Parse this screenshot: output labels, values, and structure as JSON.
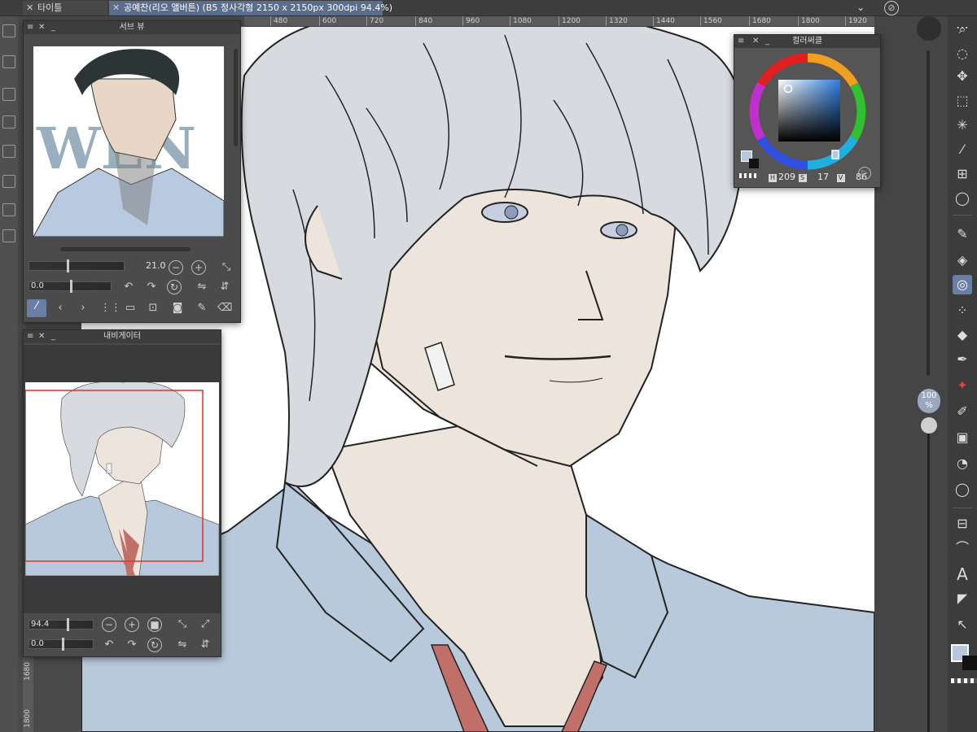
{
  "tabs": [
    {
      "label": "타이틀"
    },
    {
      "label": "공예찬(리오 앨버튼) (B5 정사각형 2150 x 2150px 300dpi 94.4%)"
    }
  ],
  "ruler": {
    "top_ticks": [
      "480",
      "600",
      "720",
      "840",
      "960",
      "1080",
      "1200",
      "1320",
      "1440",
      "1560",
      "1680",
      "1800",
      "1920"
    ],
    "left_ticks": [
      "1680",
      "1800"
    ]
  },
  "subview": {
    "title": "서브 뷰",
    "zoom_value": "21.0",
    "rotation_value": "0.0",
    "image_text": "WEN"
  },
  "navigator": {
    "title": "내비게이터",
    "zoom_value": "94.4",
    "rotation_value": "0.0"
  },
  "colorwheel": {
    "title": "컬러써클",
    "h_label": "H",
    "h_value": "209",
    "s_label": "S",
    "s_value": "17",
    "v_label": "V",
    "v_value": "86",
    "current_color": "#b7c8dd"
  },
  "zoom_badge": {
    "line1": "100",
    "line2": "%"
  },
  "colors": {
    "shirt": "#b8c9db",
    "skin": "#ede5dc",
    "hair": "#d7dbe0",
    "tie": "#c07068",
    "accent": "#6b7fa5"
  }
}
